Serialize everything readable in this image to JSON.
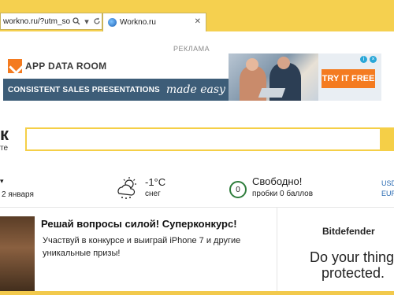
{
  "browser": {
    "address": "workno.ru/?utm_source=",
    "tab_title": "Workno.ru"
  },
  "ad": {
    "label": "РЕКЛАМА",
    "brand": "APP DATA ROOM",
    "headline": "CONSISTENT SALES PRESENTATIONS",
    "tagline": "made easy",
    "cta": "TRY IT FREE"
  },
  "header": {
    "logo_fragment": "к",
    "logo_sub": "те"
  },
  "info": {
    "date": "2 января",
    "temperature": "-1°C",
    "condition": "снег",
    "traffic_title": "Свободно!",
    "traffic_sub": "пробки 0 баллов",
    "traffic_score": "0",
    "currency1": "USD",
    "currency2": "EUR"
  },
  "promo": {
    "title": "Решай вопросы силой! Суперконкурс!",
    "text": "Участвуй в конкурсе и выиграй iPhone 7 и другие уникальные призы!"
  },
  "side_ad": {
    "brand": "Bitdefender",
    "line1": "Do your thing",
    "line2": "protected."
  },
  "colors": {
    "chrome": "#f5d04f",
    "accent_yellow": "#f5cf47",
    "ad_orange": "#f47b20",
    "ad_blue": "#3d5d78",
    "traffic_green": "#2f7d3c"
  }
}
